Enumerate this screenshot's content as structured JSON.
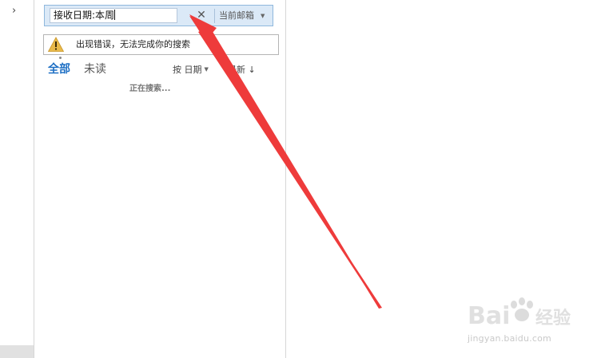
{
  "nav": {
    "expand_glyph": "›"
  },
  "search": {
    "query": "接收日期:本周",
    "clear_glyph": "✕",
    "scope": "当前邮箱"
  },
  "error": {
    "message": "出现错误，无法完成你的搜索"
  },
  "filters": {
    "all": "全部",
    "unread": "未读"
  },
  "sort": {
    "by": "按 日期",
    "order": "最新 ↓"
  },
  "status": {
    "searching": "正在搜索..."
  },
  "watermark": {
    "logo_text": "Baidu 经验",
    "url": "jingyan.baidu.com"
  },
  "colors": {
    "accent": "#1e6fc4",
    "arrow": "#ee3b3b",
    "warning": "#e8b94a"
  }
}
